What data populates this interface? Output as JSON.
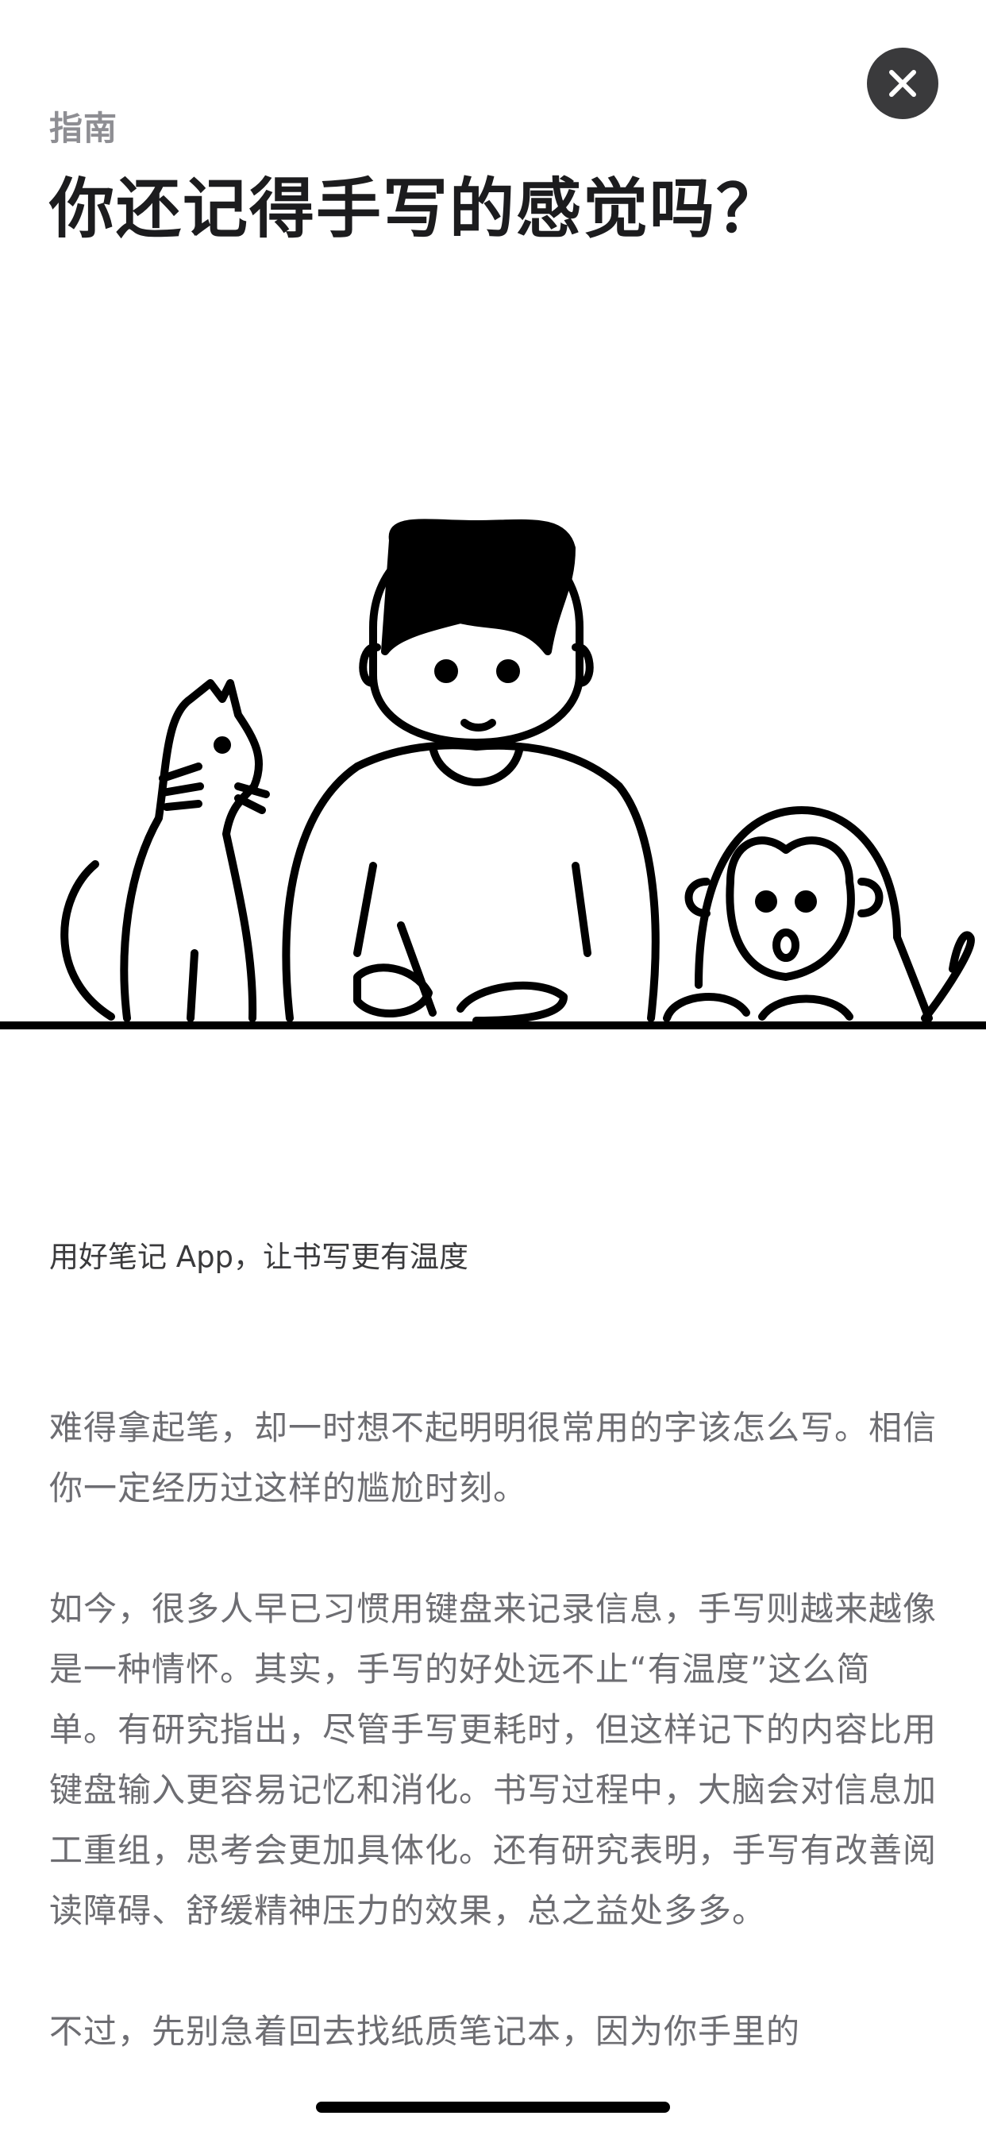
{
  "colors": {
    "background": "#ffffff",
    "title": "#1c1c1e",
    "eyebrow": "#8e8e93",
    "body": "#6d6d72",
    "close_button": "#3a3a3c",
    "line_art": "#000000"
  },
  "header": {
    "eyebrow": "指南",
    "title": "你还记得手写的感觉吗？",
    "close_icon": "close-icon"
  },
  "hero": {
    "illustration": "person-writing-with-cat-and-monkey"
  },
  "subtitle": "用好笔记 App，让书写更有温度",
  "article": {
    "paragraphs": [
      "难得拿起笔，却一时想不起明明很常用的字该怎么写。相信你一定经历过这样的尴尬时刻。",
      "如今，很多人早已习惯用键盘来记录信息，手写则越来越像是一种情怀。其实，手写的好处远不止“有温度”这么简单。有研究指出，尽管手写更耗时，但这样记下的内容比用键盘输入更容易记忆和消化。书写过程中，大脑会对信息加工重组，思考会更加具体化。还有研究表明，手写有改善阅读障碍、舒缓精神压力的效果，总之益处多多。",
      "不过，先别急着回去找纸质笔记本，因为你手里的"
    ]
  }
}
